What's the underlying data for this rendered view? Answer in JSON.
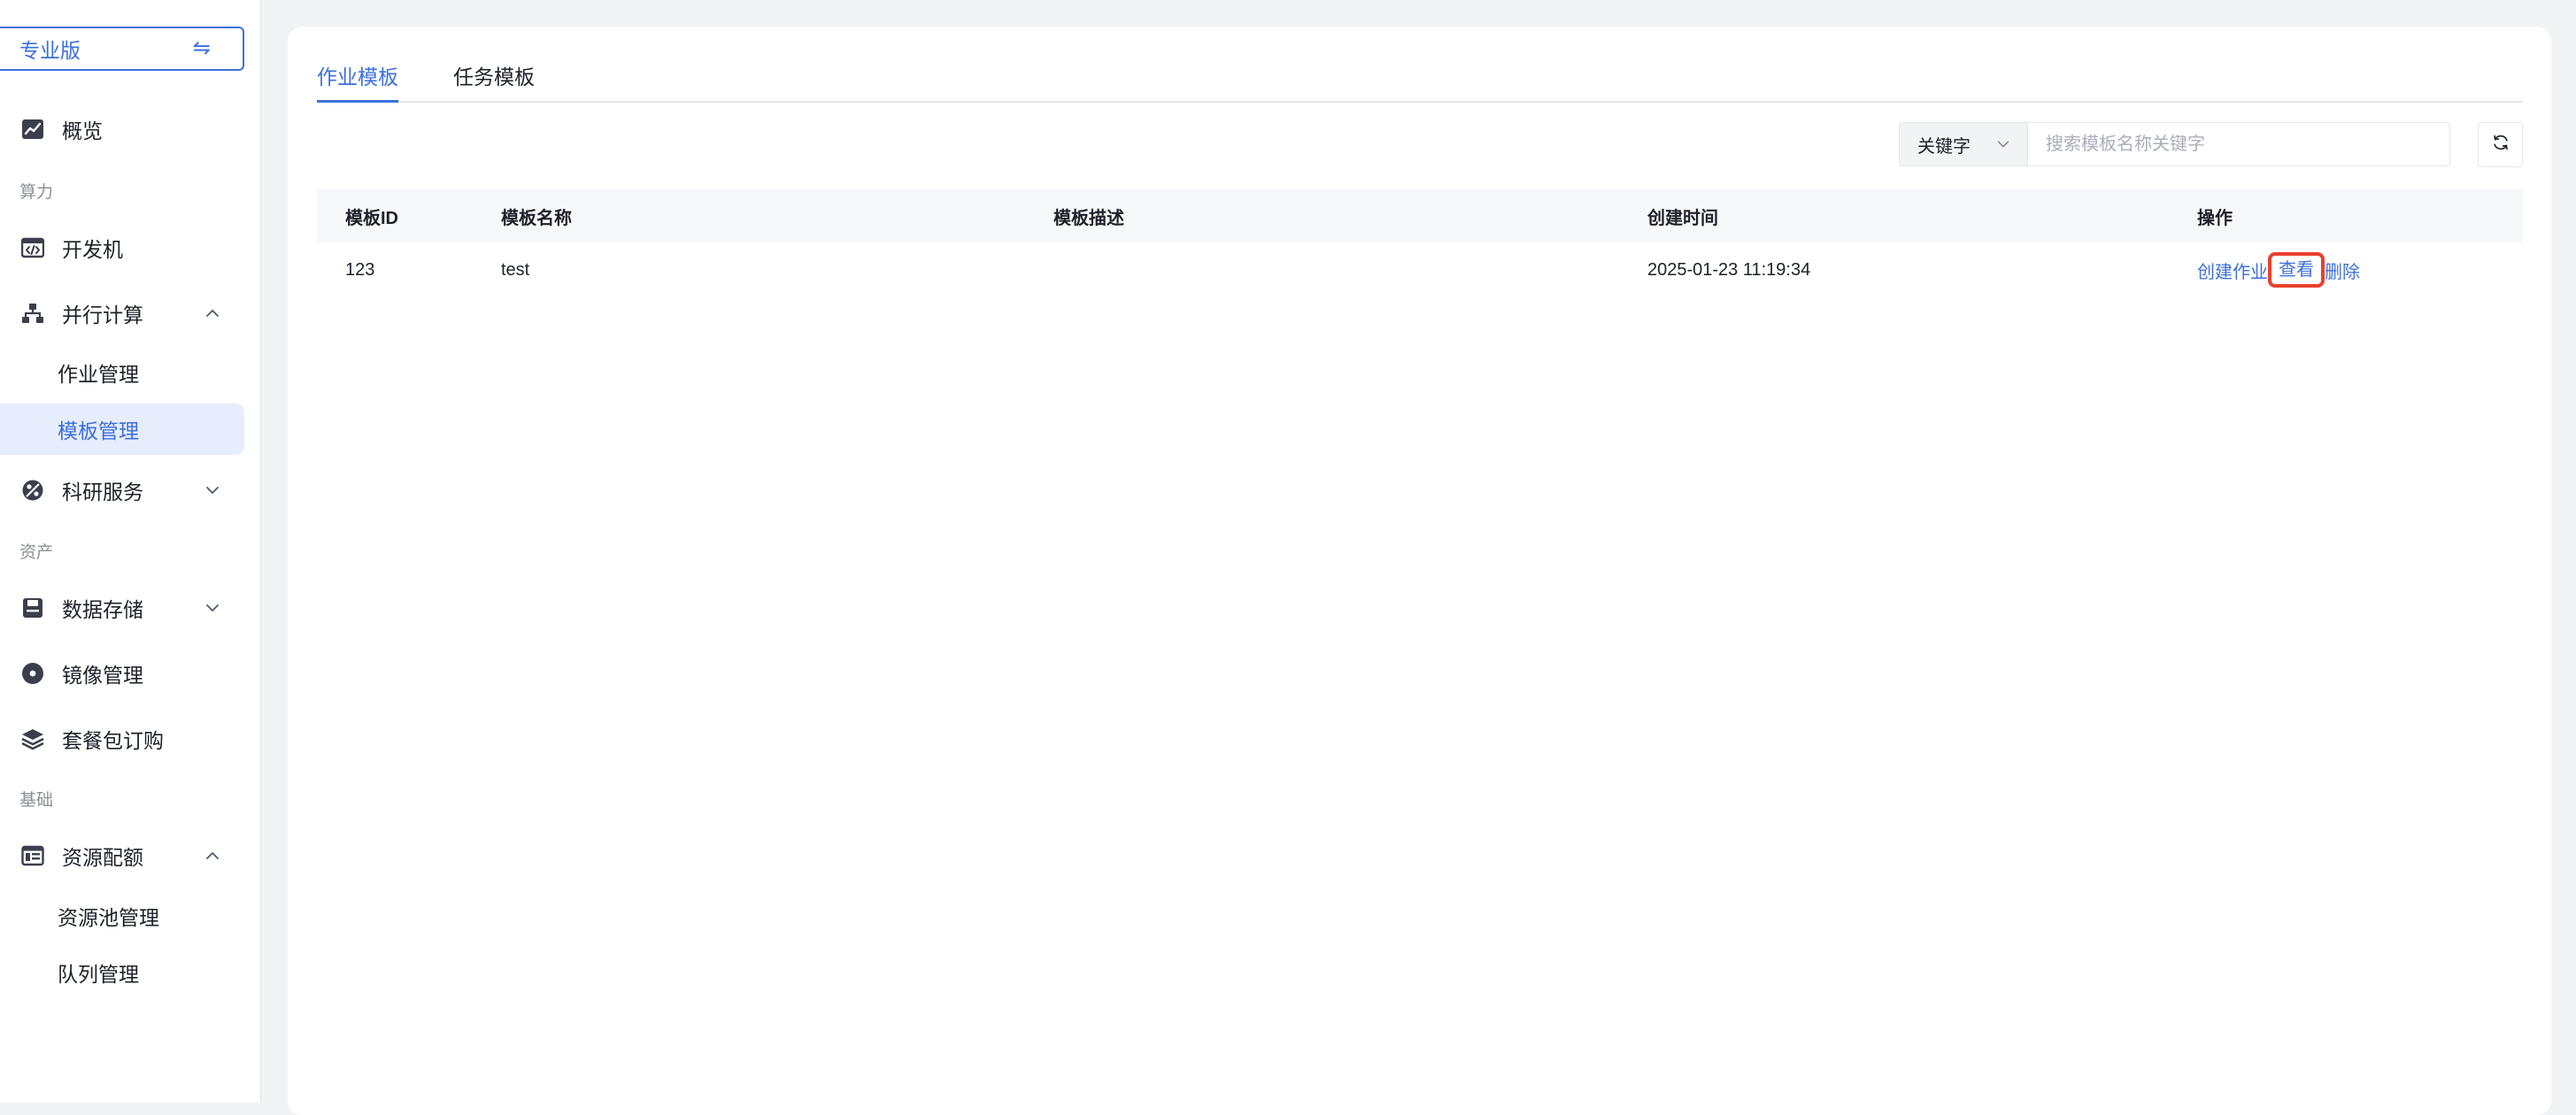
{
  "sidebar": {
    "edition_label": "专业版",
    "swap_symbol": "⇋",
    "overview": "概览",
    "group_compute": "算力",
    "dev_machine": "开发机",
    "parallel_compute": "并行计算",
    "job_management": "作业管理",
    "template_management": "模板管理",
    "research_services": "科研服务",
    "group_assets": "资产",
    "data_storage": "数据存储",
    "image_management": "镜像管理",
    "package_purchase": "套餐包订购",
    "group_basic": "基础",
    "resource_quota": "资源配额",
    "pool_management": "资源池管理",
    "queue_management": "队列管理"
  },
  "tabs": {
    "job_templates": "作业模板",
    "task_templates": "任务模板"
  },
  "search": {
    "field_select": "关键字",
    "placeholder": "搜索模板名称关键字"
  },
  "table": {
    "headers": {
      "id": "模板ID",
      "name": "模板名称",
      "desc": "模板描述",
      "created": "创建时间",
      "ops": "操作"
    },
    "rows": [
      {
        "id": "123",
        "name": "test",
        "desc": "",
        "created": "2025-01-23 11:19:34",
        "op_create": "创建作业",
        "op_view": "查看",
        "op_delete": "删除"
      }
    ]
  },
  "colors": {
    "accent": "#3c6fde",
    "highlight_border": "#e8402e",
    "active_bg": "#e6edfc"
  }
}
